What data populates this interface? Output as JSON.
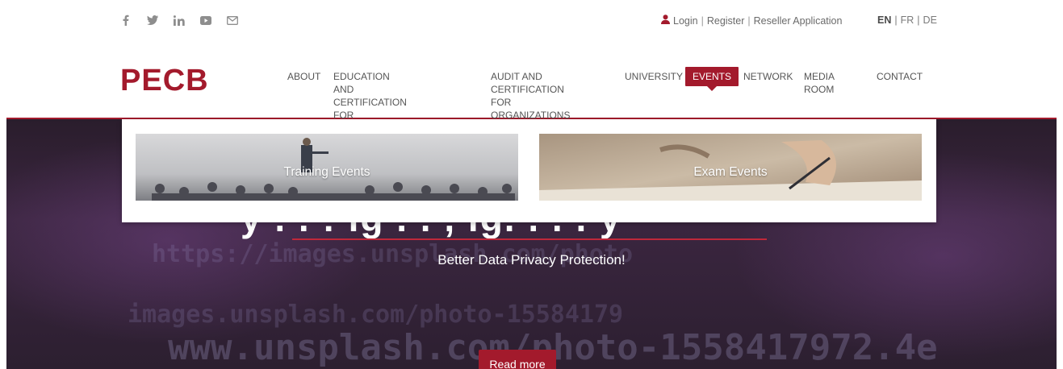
{
  "topbar": {
    "social_icons": [
      "facebook-icon",
      "twitter-icon",
      "linkedin-icon",
      "youtube-icon",
      "mail-icon"
    ],
    "login": "Login",
    "register": "Register",
    "reseller": "Reseller Application",
    "separator": "|",
    "languages": [
      "EN",
      "FR",
      "DE"
    ],
    "active_language": "EN"
  },
  "header": {
    "logo": "PECB",
    "nav": [
      {
        "label_line1": "ABOUT",
        "label_line2": ""
      },
      {
        "label_line1": "EDUCATION AND CERTIFICATION",
        "label_line2": "FOR INDIVIDUALS"
      },
      {
        "label_line1": "AUDIT AND CERTIFICATION",
        "label_line2": "FOR ORGANIZATIONS"
      },
      {
        "label_line1": "UNIVERSITY",
        "label_line2": ""
      },
      {
        "label_line1": "EVENTS",
        "label_line2": ""
      },
      {
        "label_line1": "NETWORK",
        "label_line2": ""
      },
      {
        "label_line1": "MEDIA ROOM",
        "label_line2": ""
      },
      {
        "label_line1": "CONTACT",
        "label_line2": ""
      }
    ],
    "active_nav": "EVENTS"
  },
  "dropdown": {
    "cards": [
      {
        "label": "Training Events"
      },
      {
        "label": "Exam Events"
      }
    ]
  },
  "hero": {
    "title_fragment": "y    .    . :    ig  . . ,  ig. . .  . y",
    "subtitle": "Better Data Privacy Protection!",
    "button": "Read more",
    "background_text_1": "https://images.unsplash.com/photo",
    "background_text_2": "www.unsplash.com/photo-1558417972.4e",
    "background_text_3": "images.unsplash.com/photo-15584179"
  },
  "colors": {
    "brand": "#a31a2c",
    "hero_bg": "#2c1f30",
    "nav_text": "#555555"
  }
}
